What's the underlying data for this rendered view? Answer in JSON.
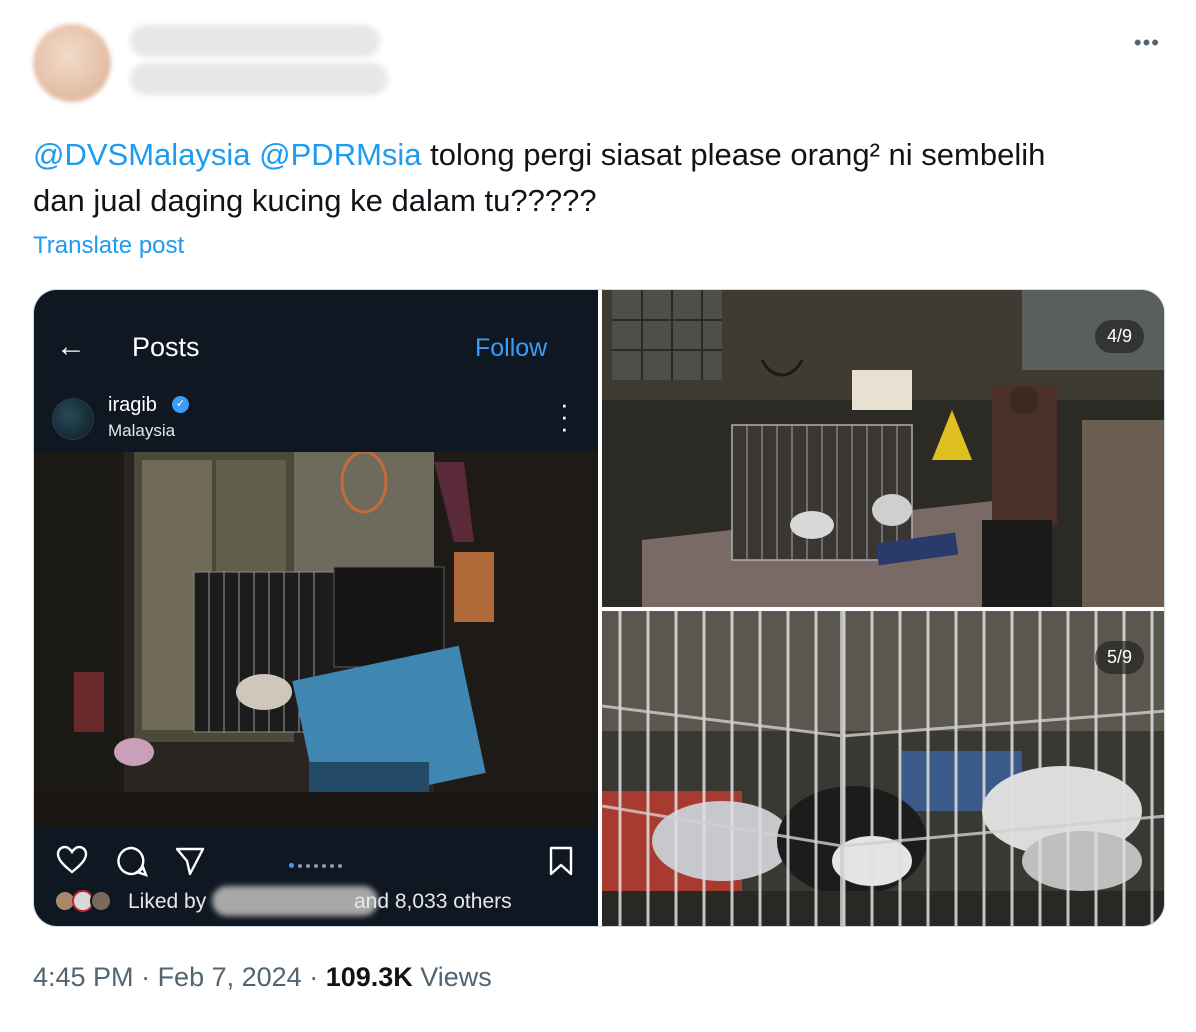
{
  "tweet": {
    "mention_1": "@DVSMalaysia",
    "mention_2": "@PDRMsia",
    "text_line_1": " tolong pergi siasat please orang² ni sembelih",
    "text_line_2": "dan jual daging kucing ke dalam tu?????",
    "translate_label": "Translate post",
    "more_icon": "more-horizontal-icon"
  },
  "media": {
    "instagram": {
      "header_title": "Posts",
      "follow_label": "Follow",
      "username": "iragib",
      "location": "Malaysia",
      "liked_prefix": "Liked by",
      "liked_suffix": "and 8,033 others",
      "carousel_count": 7,
      "carousel_active": 1,
      "accent_color": "#3b9df8"
    },
    "photo_counter_1": "4/9",
    "photo_counter_2": "5/9"
  },
  "meta": {
    "time": "4:45 PM",
    "separator": " · ",
    "date": "Feb 7, 2024",
    "views_count": "109.3K",
    "views_label": " Views"
  },
  "colors": {
    "link": "#1d9bf0",
    "text": "#0f1419",
    "secondary": "#536471"
  }
}
